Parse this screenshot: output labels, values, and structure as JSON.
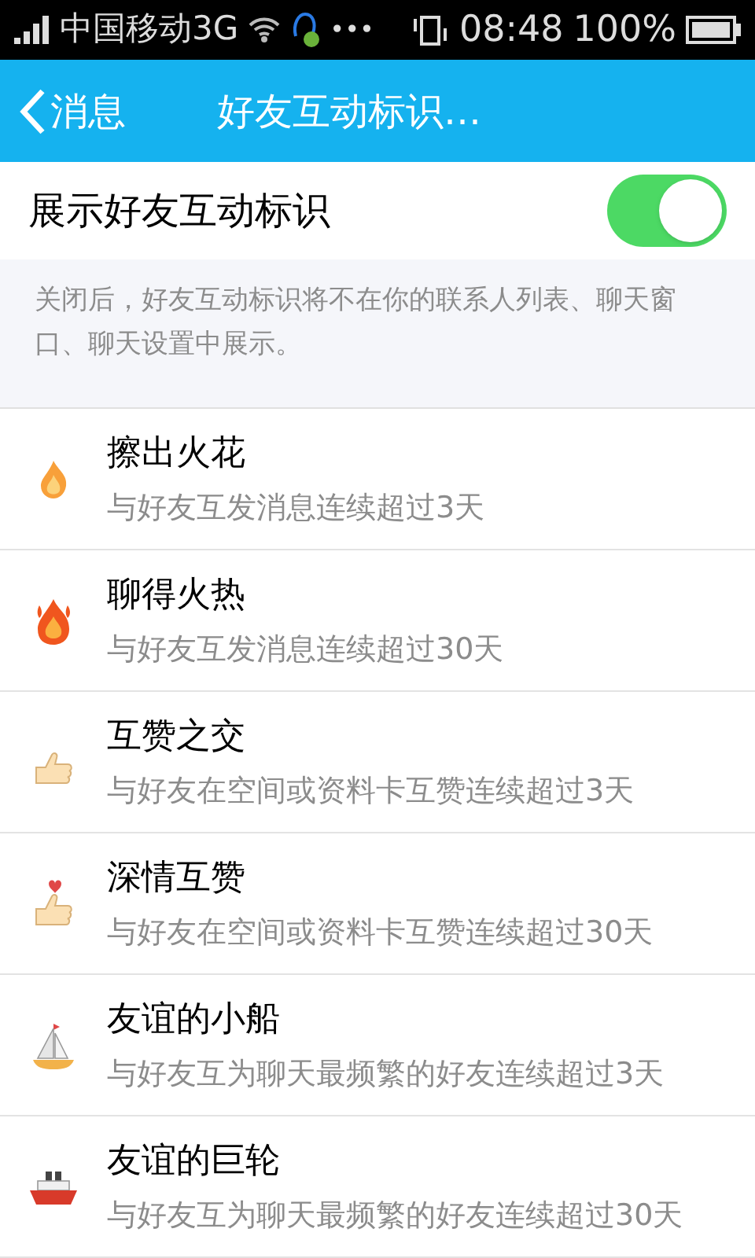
{
  "status_bar": {
    "carrier": "中国移动3G",
    "more": "•••",
    "time": "08:48",
    "battery": "100%"
  },
  "header": {
    "back": "消息",
    "title": "好友互动标识…"
  },
  "toggle": {
    "label": "展示好友互动标识",
    "on": true
  },
  "note": "关闭后，好友互动标识将不在你的联系人列表、聊天窗口、聊天设置中展示。",
  "items": [
    {
      "kind": "flame",
      "title": "擦出火花",
      "desc": "与好友互发消息连续超过3天"
    },
    {
      "kind": "big-flame",
      "title": "聊得火热",
      "desc": "与好友互发消息连续超过30天"
    },
    {
      "kind": "thumb",
      "title": "互赞之交",
      "desc": "与好友在空间或资料卡互赞连续超过3天"
    },
    {
      "kind": "thumb-heart",
      "title": "深情互赞",
      "desc": "与好友在空间或资料卡互赞连续超过30天"
    },
    {
      "kind": "sailboat",
      "title": "友谊的小船",
      "desc": "与好友互为聊天最频繁的好友连续超过3天"
    },
    {
      "kind": "ship",
      "title": "友谊的巨轮",
      "desc": "与好友互为聊天最频繁的好友连续超过30天"
    }
  ]
}
